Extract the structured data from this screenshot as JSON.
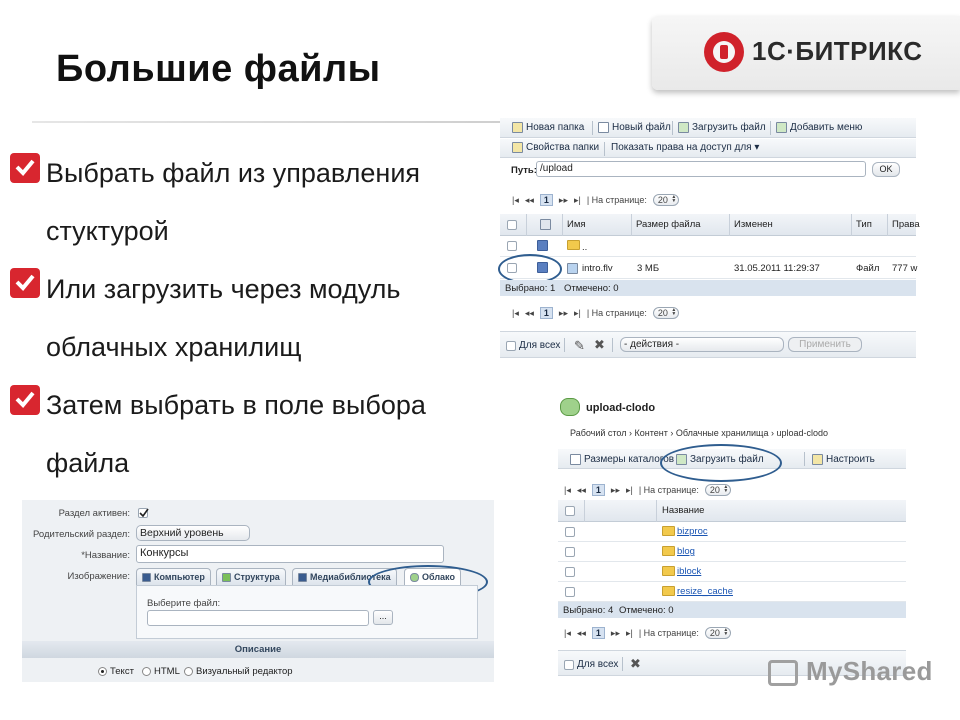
{
  "slide": {
    "title": "Большие файлы",
    "logo": "1С·БИТРИКС",
    "bullets": [
      {
        "line1": "Выбрать файл из управления",
        "line2": "стуктурой"
      },
      {
        "line1": "Или загрузить  через модуль",
        "line2": "облачных хранилищ"
      },
      {
        "line1": "Затем выбрать в поле выбора",
        "line2": "файла"
      }
    ],
    "watermark": "MyShared"
  },
  "fileman": {
    "toolbar1": [
      "Новая папка",
      "Новый файл",
      "Загрузить файл",
      "Добавить меню"
    ],
    "toolbar2": [
      "Свойства папки",
      "Показать права на доступ для ▾"
    ],
    "path_label": "Путь:",
    "path_value": "/upload",
    "ok_label": "OK",
    "pager_page": "1",
    "per_page_label": "На странице:",
    "per_page_value": "20",
    "columns": [
      "Имя",
      "Размер файла",
      "Изменен",
      "Тип",
      "Права"
    ],
    "rows": [
      {
        "name": "..",
        "size": "",
        "modified": "",
        "type": "",
        "rights": ""
      },
      {
        "name": "intro.flv",
        "size": "3 МБ",
        "modified": "31.05.2011 11:29:37",
        "type": "Файл",
        "rights": "777 w"
      }
    ],
    "status_selected": "Выбрано: 1",
    "status_marked": "Отмечено: 0",
    "for_all_label": "Для всех",
    "actions_placeholder": "- действия -",
    "apply_label": "Применить"
  },
  "cloud": {
    "title": "upload-clodo",
    "breadcrumb": "Рабочий стол › Контент › Облачные хранилища › upload-clodo",
    "toolbar": [
      "Размеры каталогов",
      "Загрузить файл",
      "Настроить"
    ],
    "pager_page": "1",
    "per_page_label": "На странице:",
    "per_page_value": "20",
    "column_name": "Название",
    "folders": [
      "bizproc",
      "blog",
      "iblock",
      "resize_cache"
    ],
    "status_selected": "Выбрано: 4",
    "status_marked": "Отмечено: 0",
    "for_all_label": "Для всех"
  },
  "form": {
    "active_label": "Раздел активен:",
    "parent_label": "Родительский раздел:",
    "parent_value": "Верхний уровень",
    "name_label": "*Название:",
    "name_value": "Конкурсы",
    "image_label": "Изображение:",
    "tabs": [
      "Компьютер",
      "Структура",
      "Медиабиблиотека",
      "Облако"
    ],
    "choose_file_label": "Выберите файл:",
    "browse_label": "...",
    "description_header": "Описание",
    "radio_options": [
      "Текст",
      "HTML",
      "Визуальный редактор"
    ]
  }
}
